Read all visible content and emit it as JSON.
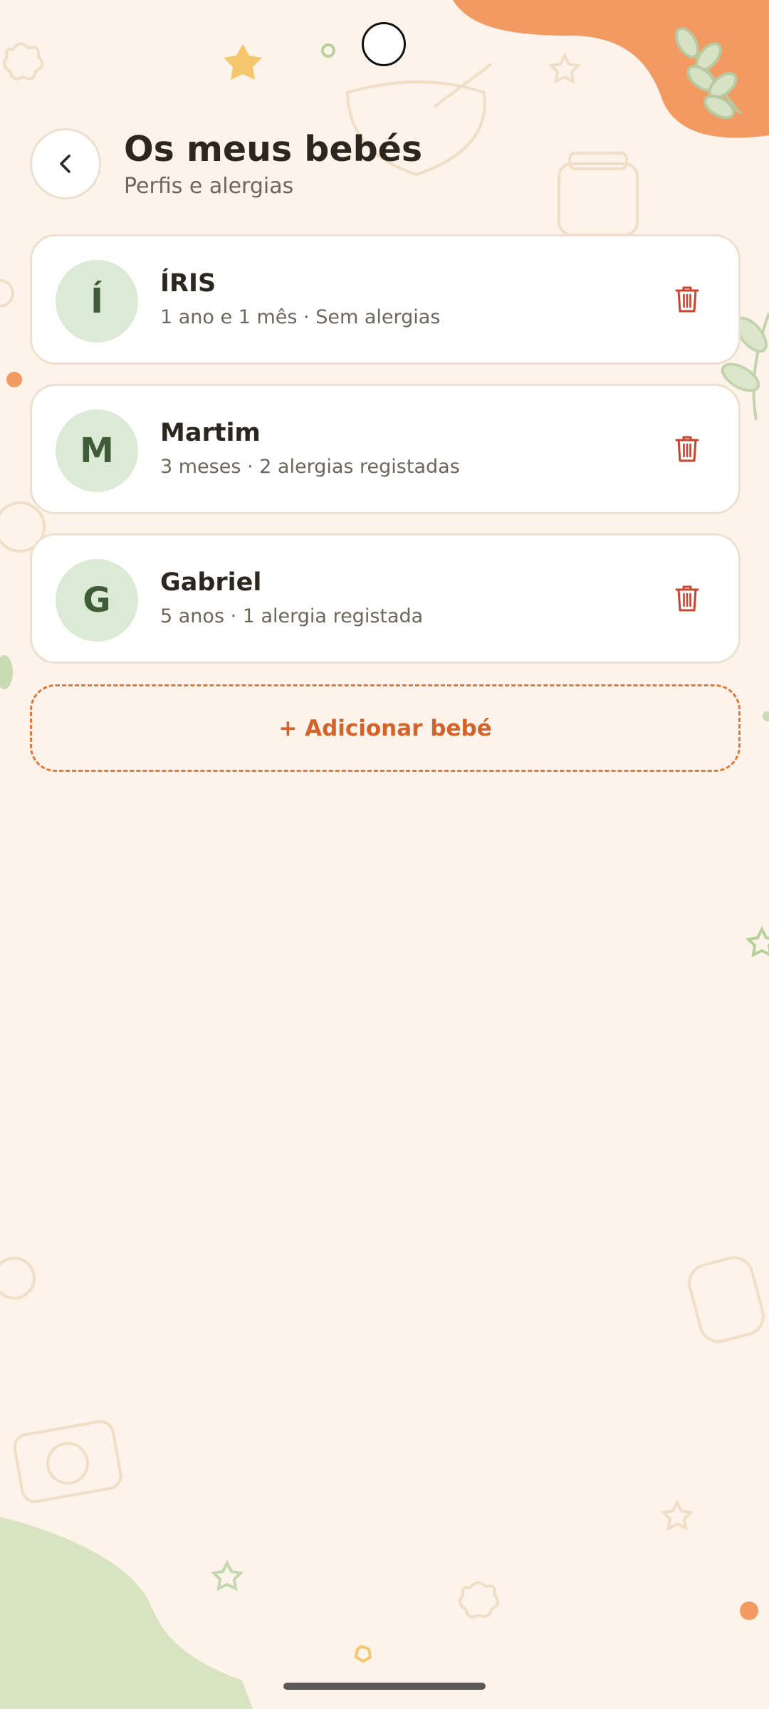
{
  "header": {
    "title": "Os meus bebés",
    "subtitle": "Perfis e alergias"
  },
  "babies": [
    {
      "initial": "Í",
      "name": "ÍRIS",
      "details": "1 ano e 1 mês · Sem alergias"
    },
    {
      "initial": "M",
      "name": "Martim",
      "details": "3 meses · 2 alergias registadas"
    },
    {
      "initial": "G",
      "name": "Gabriel",
      "details": "5 anos · 1 alergia registada"
    }
  ],
  "add_button": {
    "label": "+ Adicionar bebé"
  },
  "icons": {
    "back": "chevron-left-icon",
    "delete": "trash-icon"
  },
  "colors": {
    "background": "#fdf3ea",
    "accent_orange": "#e07a3c",
    "avatar_green": "#dce9d5",
    "avatar_text": "#3d5c37",
    "delete_red": "#c9442f",
    "card_border": "#eee0cc"
  }
}
